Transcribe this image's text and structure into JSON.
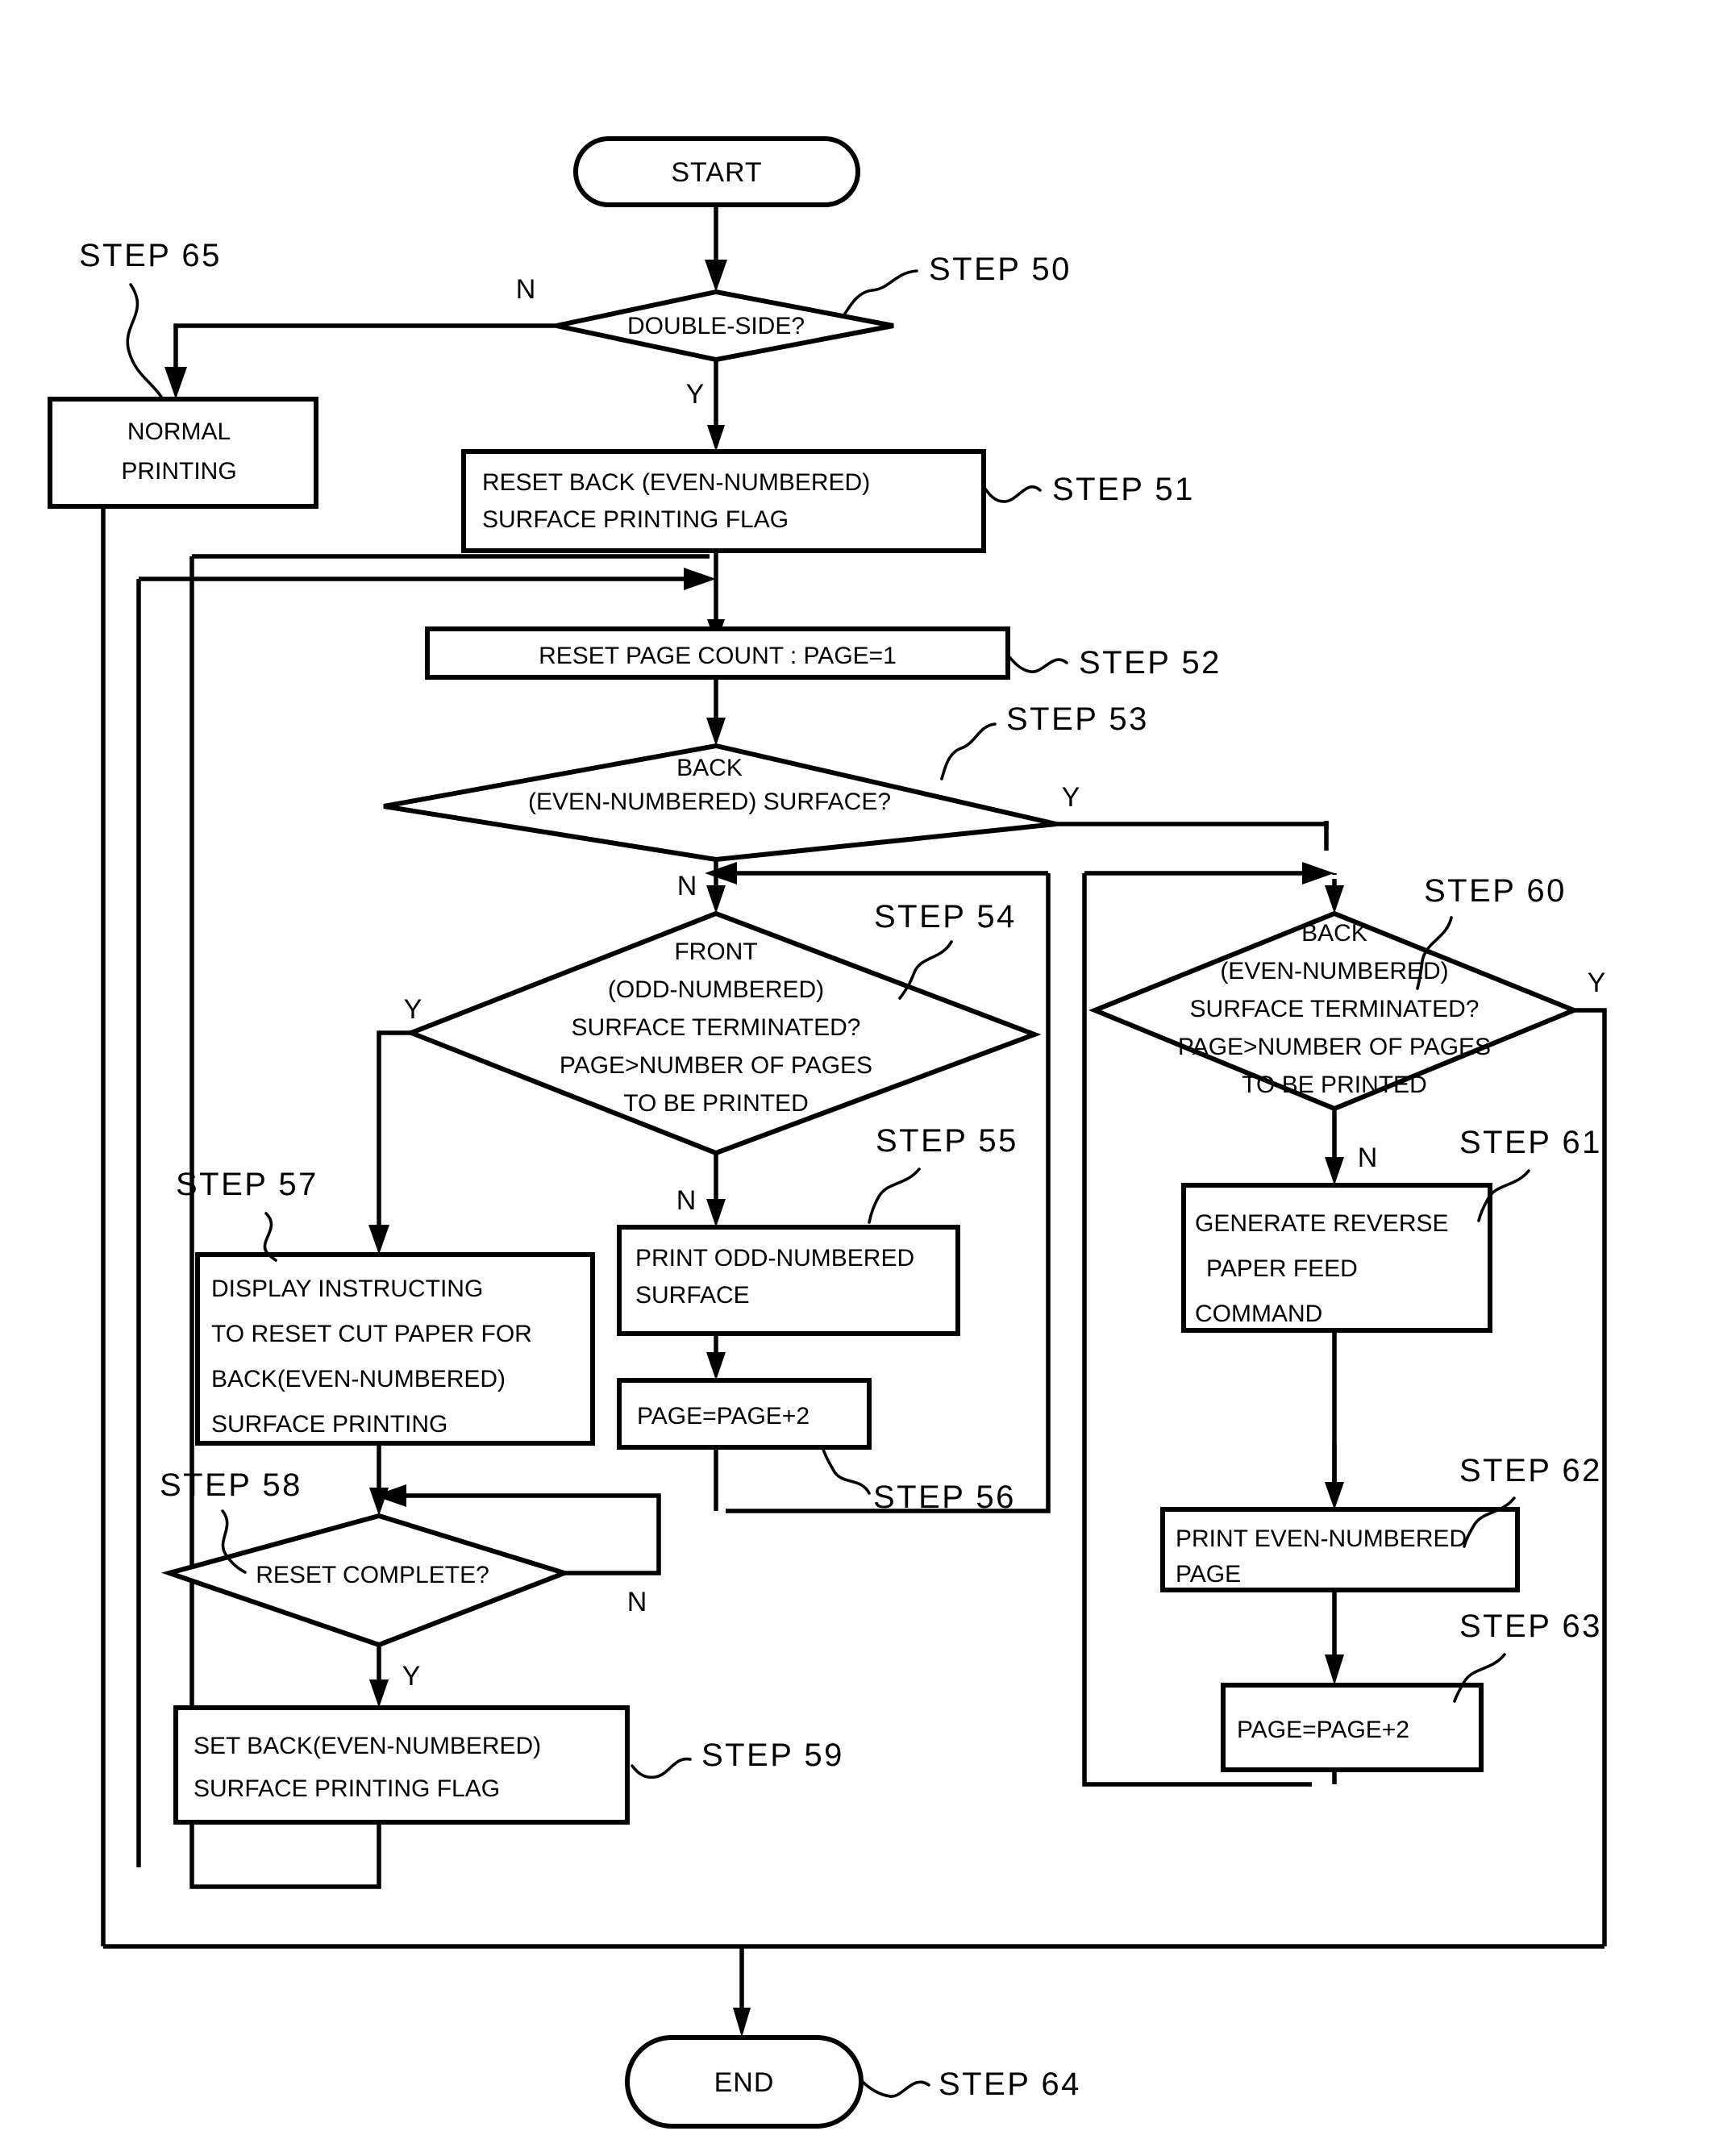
{
  "diagram": {
    "type": "flowchart",
    "title": "Double-sided printing control flowchart",
    "terminators": {
      "start": "START",
      "end": "END"
    },
    "branch_labels": {
      "yes": "Y",
      "no": "N"
    },
    "nodes": [
      {
        "id": "start",
        "kind": "terminator",
        "label": "START"
      },
      {
        "id": "step50",
        "kind": "decision",
        "step": "STEP 50",
        "lines": [
          "DOUBLE-SIDE?"
        ]
      },
      {
        "id": "step65",
        "kind": "process",
        "step": "STEP 65",
        "lines": [
          "NORMAL",
          "PRINTING"
        ]
      },
      {
        "id": "step51",
        "kind": "process",
        "step": "STEP 51",
        "lines": [
          "RESET BACK (EVEN-NUMBERED)",
          "SURFACE PRINTING FLAG"
        ]
      },
      {
        "id": "step52",
        "kind": "process",
        "step": "STEP 52",
        "lines": [
          "RESET PAGE COUNT : PAGE=1"
        ]
      },
      {
        "id": "step53",
        "kind": "decision",
        "step": "STEP 53",
        "lines": [
          "BACK",
          "(EVEN-NUMBERED) SURFACE?"
        ]
      },
      {
        "id": "step54",
        "kind": "decision",
        "step": "STEP 54",
        "lines": [
          "FRONT",
          "(ODD-NUMBERED)",
          "SURFACE TERMINATED?",
          "PAGE>NUMBER OF PAGES",
          "TO BE PRINTED"
        ]
      },
      {
        "id": "step55",
        "kind": "process",
        "step": "STEP 55",
        "lines": [
          "PRINT ODD-NUMBERED",
          "SURFACE"
        ]
      },
      {
        "id": "step56",
        "kind": "process",
        "step": "STEP 56",
        "lines": [
          "PAGE=PAGE+2"
        ]
      },
      {
        "id": "step57",
        "kind": "process",
        "step": "STEP 57",
        "lines": [
          "DISPLAY INSTRUCTING",
          "TO RESET CUT PAPER FOR",
          "BACK(EVEN-NUMBERED)",
          "SURFACE PRINTING"
        ]
      },
      {
        "id": "step58",
        "kind": "decision",
        "step": "STEP 58",
        "lines": [
          "RESET COMPLETE?"
        ]
      },
      {
        "id": "step59",
        "kind": "process",
        "step": "STEP 59",
        "lines": [
          "SET BACK(EVEN-NUMBERED)",
          "SURFACE PRINTING FLAG"
        ]
      },
      {
        "id": "step60",
        "kind": "decision",
        "step": "STEP 60",
        "lines": [
          "BACK",
          "(EVEN-NUMBERED)",
          "SURFACE TERMINATED?",
          "PAGE>NUMBER OF PAGES",
          "TO BE PRINTED"
        ]
      },
      {
        "id": "step61",
        "kind": "process",
        "step": "STEP 61",
        "lines": [
          "GENERATE REVERSE",
          "PAPER FEED",
          "COMMAND"
        ]
      },
      {
        "id": "step62",
        "kind": "process",
        "step": "STEP 62",
        "lines": [
          "PRINT EVEN-NUMBERED",
          "PAGE"
        ]
      },
      {
        "id": "step63",
        "kind": "process",
        "step": "STEP 63",
        "lines": [
          "PAGE=PAGE+2"
        ]
      },
      {
        "id": "step64",
        "kind": "terminator",
        "step": "STEP 64",
        "lines": [
          "END"
        ]
      }
    ],
    "step_labels": {
      "s50": "STEP 50",
      "s51": "STEP 51",
      "s52": "STEP 52",
      "s53": "STEP 53",
      "s54": "STEP 54",
      "s55": "STEP 55",
      "s56": "STEP 56",
      "s57": "STEP 57",
      "s58": "STEP 58",
      "s59": "STEP 59",
      "s60": "STEP 60",
      "s61": "STEP 61",
      "s62": "STEP 62",
      "s63": "STEP 63",
      "s64": "STEP 64",
      "s65": "STEP 65"
    },
    "text": {
      "start": "START",
      "end": "END",
      "n50_l1": "DOUBLE-SIDE?",
      "n65_l1": "NORMAL",
      "n65_l2": "PRINTING",
      "n51_l1": "RESET BACK (EVEN-NUMBERED)",
      "n51_l2": "SURFACE PRINTING FLAG",
      "n52_l1": "RESET PAGE COUNT : PAGE=1",
      "n53_l1": "BACK",
      "n53_l2": "(EVEN-NUMBERED) SURFACE?",
      "n54_l1": "FRONT",
      "n54_l2": "(ODD-NUMBERED)",
      "n54_l3": "SURFACE TERMINATED?",
      "n54_l4": "PAGE>NUMBER OF PAGES",
      "n54_l5": "TO BE PRINTED",
      "n55_l1": "PRINT ODD-NUMBERED",
      "n55_l2": "SURFACE",
      "n56_l1": "PAGE=PAGE+2",
      "n57_l1": "DISPLAY INSTRUCTING",
      "n57_l2": "TO RESET CUT PAPER FOR",
      "n57_l3": "BACK(EVEN-NUMBERED)",
      "n57_l4": "SURFACE PRINTING",
      "n58_l1": "RESET COMPLETE?",
      "n59_l1": "SET BACK(EVEN-NUMBERED)",
      "n59_l2": "SURFACE PRINTING FLAG",
      "n60_l1": "BACK",
      "n60_l2": "(EVEN-NUMBERED)",
      "n60_l3": "SURFACE TERMINATED?",
      "n60_l4": "PAGE>NUMBER OF PAGES",
      "n60_l5": "TO BE PRINTED",
      "n61_l1": "GENERATE REVERSE",
      "n61_l2": "PAPER FEED",
      "n61_l3": "COMMAND",
      "n62_l1": "PRINT EVEN-NUMBERED",
      "n62_l2": "PAGE",
      "n63_l1": "PAGE=PAGE+2",
      "yn_n50_no": "N",
      "yn_n50_yes": "Y",
      "yn_n53_yes": "Y",
      "yn_n53_no": "N",
      "yn_n54_yes": "Y",
      "yn_n54_no": "N",
      "yn_n58_no": "N",
      "yn_n58_yes": "Y",
      "yn_n60_yes": "Y",
      "yn_n60_no": "N"
    },
    "colors": {
      "ink": "#000000",
      "paper": "#ffffff"
    }
  }
}
